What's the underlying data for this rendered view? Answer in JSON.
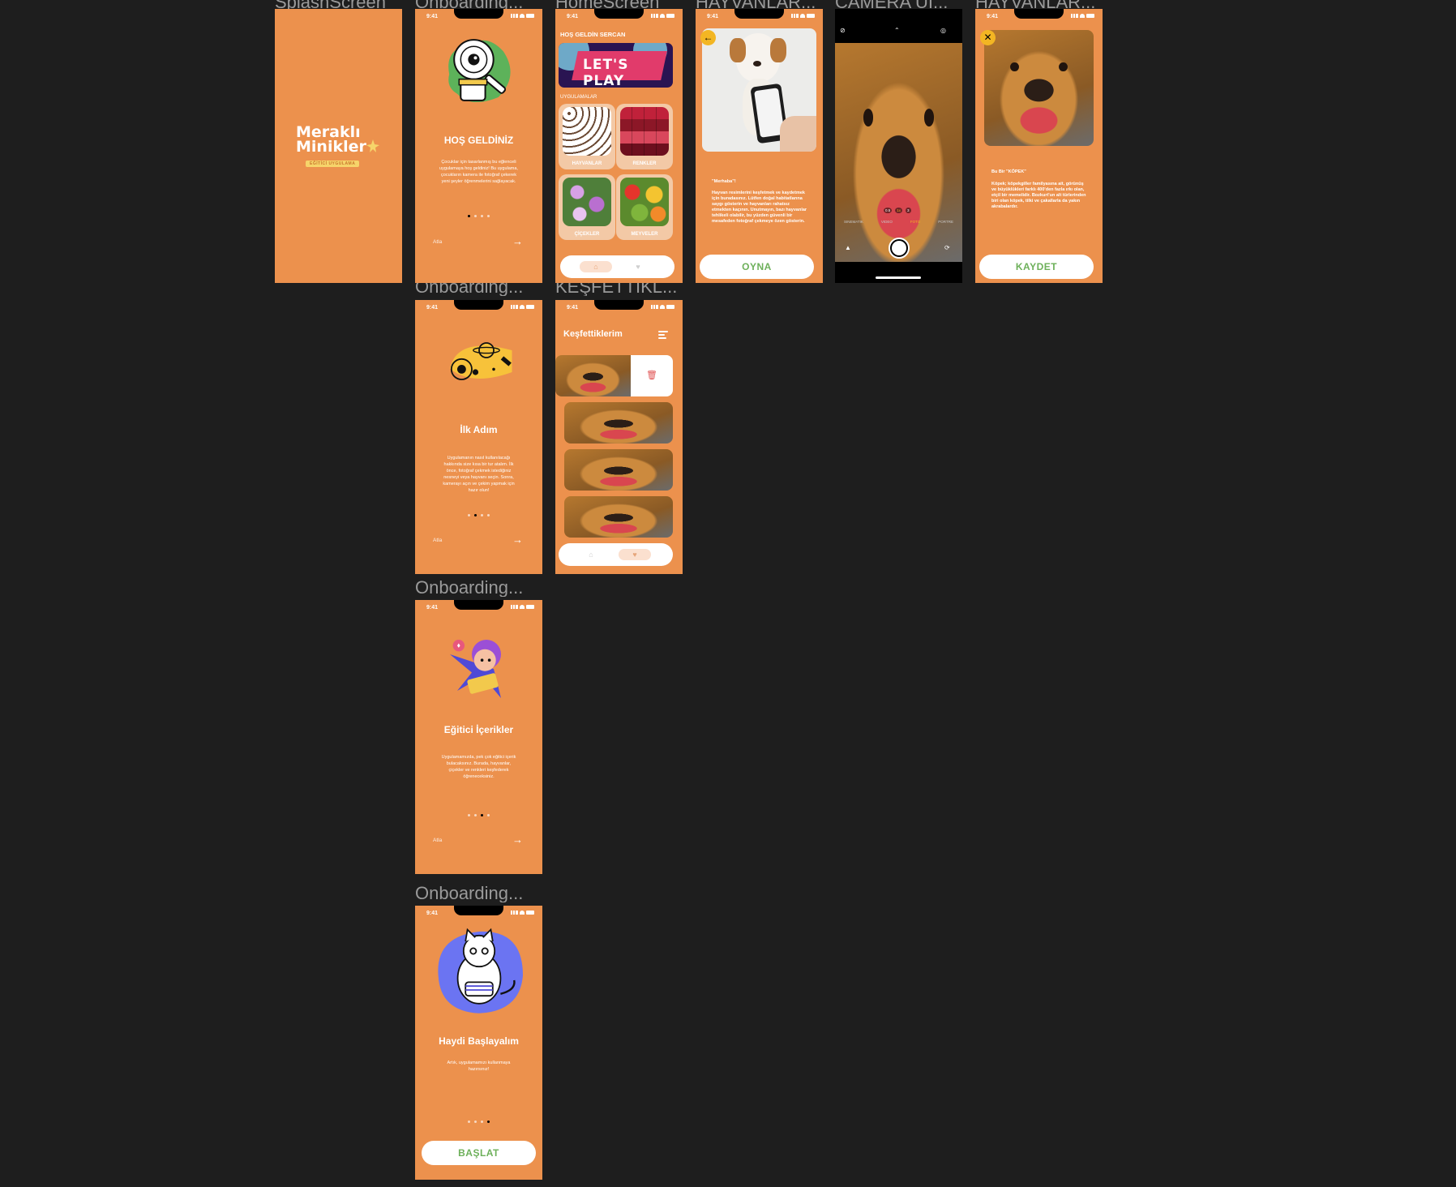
{
  "frames": {
    "splash": "SplashScreen",
    "onboarding1": "Onboarding...",
    "home": "HomeScreen",
    "hayvan1": "HAYVANLAR...",
    "camera": "CAMERA UI...",
    "hayvan2": "HAYVANLAR...",
    "onboarding2": "Onboarding...",
    "kesfettik": "KEŞFETTİKL...",
    "onboarding3": "Onboarding...",
    "onboarding4": "Onboarding..."
  },
  "status": {
    "time": "9:41"
  },
  "splash": {
    "line1": "Meraklı",
    "line2": "Minikler",
    "tagline": "EĞİTİCİ UYGULAMA"
  },
  "onboarding": [
    {
      "title": "HOŞ GELDİNİZ",
      "body": "Çocuklar için tasarlanmış bu eğlenceli uygulamaya hoş geldiniz! Bu uygulama, çocukların kamera ile fotoğraf çekerek yeni şeyler öğrenmelerini sağlayacak.",
      "skip": "Atla"
    },
    {
      "title": "İlk Adım",
      "body": "Uygulamanın nasıl kullanılacağı hakkında size kısa bir tur atalım. İlk önce, fotoğraf çekmek istediğiniz nesneyi veya hayvanı seçin. Sonra, kamerayı açın ve çekim yapmak için hazır olun!",
      "skip": "Atla"
    },
    {
      "title": "Eğitici İçerikler",
      "body": "Uygulamamızda, pek çok eğitici içerik bulacaksınız. Burada, hayvanlar, çiçekler ve renkleri keşfederek öğreneceksiniz.",
      "skip": "Atla"
    },
    {
      "title": "Haydi Başlayalım",
      "body": "Artık, uygulamamızı kullanmaya hazırsınız!",
      "button": "BAŞLAT"
    }
  ],
  "home": {
    "greeting": "HOŞ GELDİN SERCAN",
    "banner": "LET'S PLAY",
    "section": "UYGULAMALAR",
    "tiles": [
      {
        "label": "HAYVANLAR"
      },
      {
        "label": "RENKLER"
      },
      {
        "label": "ÇİÇEKLER"
      },
      {
        "label": "MEYVELER"
      }
    ]
  },
  "hayvan1": {
    "heading": "\"Merhaba\"!",
    "body": "Hayvan resimlerini keşfetmek ve kaydetmek için buradasınız. Lütfen doğal habitatlarına saygı gösterin ve hayvanları rahatsız etmekten kaçının. Unutmayın, bazı hayvanlar tehlikeli olabilir, bu yüzden güvenli bir mesafeden fotoğraf çekmeye özen gösterin.",
    "button": "OYNA"
  },
  "camera": {
    "modes": [
      "SINEMATIK",
      "VIDEO",
      "FOTO",
      "PORTRE"
    ],
    "zoom": [
      "0.5",
      "1x",
      "3"
    ]
  },
  "hayvan2": {
    "heading": "Bu Bir \"KÖPEK\"",
    "body": "Köpek; köpekgiller familyasına ait, görünüş ve büyüklükleri farklı 400'den fazla ırkı olan, etçil bir memelidir. Bozkurt'un alt türlerinden biri olan köpek, tilki ve çakallarla da yakın akrabalardır.",
    "button": "KAYDET"
  },
  "kesfettik": {
    "title": "Keşfettiklerim"
  },
  "colors": {
    "primary": "#ec914d",
    "accent": "#f3b623",
    "button_text": "#6db05a",
    "canvas": "#1e1e1e"
  }
}
